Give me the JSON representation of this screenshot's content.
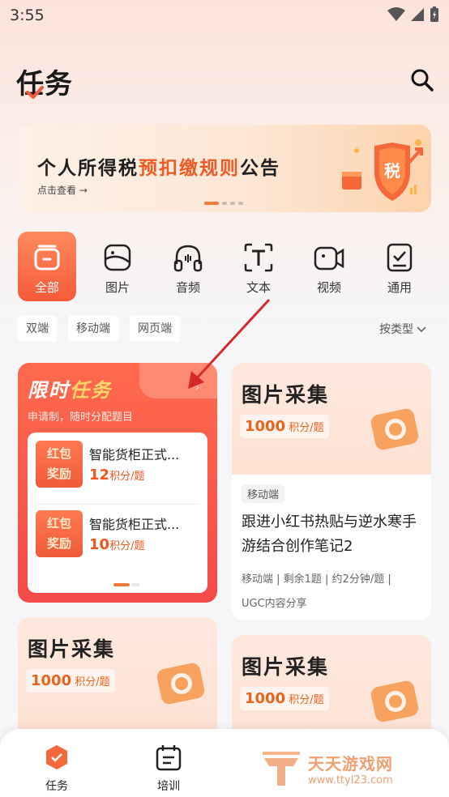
{
  "status": {
    "time": "3:55"
  },
  "header": {
    "title": "任务"
  },
  "banner": {
    "title_part1": "个人所得税",
    "title_highlight": "预扣缴规则",
    "title_part3": "公告",
    "subtitle": "点击查看 →",
    "shield_text": "税"
  },
  "categories": [
    {
      "label": "全部",
      "icon": "box-icon",
      "active": true
    },
    {
      "label": "图片",
      "icon": "image-icon",
      "active": false
    },
    {
      "label": "音频",
      "icon": "audio-icon",
      "active": false
    },
    {
      "label": "文本",
      "icon": "text-icon",
      "active": false
    },
    {
      "label": "视频",
      "icon": "video-icon",
      "active": false
    },
    {
      "label": "通用",
      "icon": "clipboard-check-icon",
      "active": false
    }
  ],
  "filters": [
    "双端",
    "移动端",
    "网页端"
  ],
  "sort_label": "按类型",
  "limited_card": {
    "title_a": "限时",
    "title_b": "任务",
    "subtitle": "申请制，随时分配题目",
    "items": [
      {
        "badge_line1": "红包",
        "badge_line2": "奖励",
        "name": "智能货柜正式...",
        "points": "12",
        "unit": "积分/题"
      },
      {
        "badge_line1": "红包",
        "badge_line2": "奖励",
        "name": "智能货柜正式...",
        "points": "10",
        "unit": "积分/题"
      }
    ]
  },
  "task_cards": [
    {
      "hero_title": "图片采集",
      "points": "1000",
      "unit": "积分/题",
      "tag": "移动端",
      "name": "跟进小红书热贴与逆水寒手游结合创作笔记2",
      "meta": "移动端 | 剩余1题 | 约2分钟/题 |",
      "category": "UGC内容分享"
    },
    {
      "hero_title": "图片采集",
      "points": "1000",
      "unit": "积分/题"
    },
    {
      "hero_title": "图片采集",
      "points": "1000",
      "unit": "积分/题"
    }
  ],
  "bottom_nav": [
    {
      "label": "任务",
      "icon": "task-check-icon"
    },
    {
      "label": "培训",
      "icon": "training-calendar-icon"
    }
  ],
  "watermark": {
    "name": "天天游戏网",
    "url": "www.ttyl23.com"
  },
  "colors": {
    "accent": "#f55a3a",
    "orange_text": "#e8641c"
  }
}
